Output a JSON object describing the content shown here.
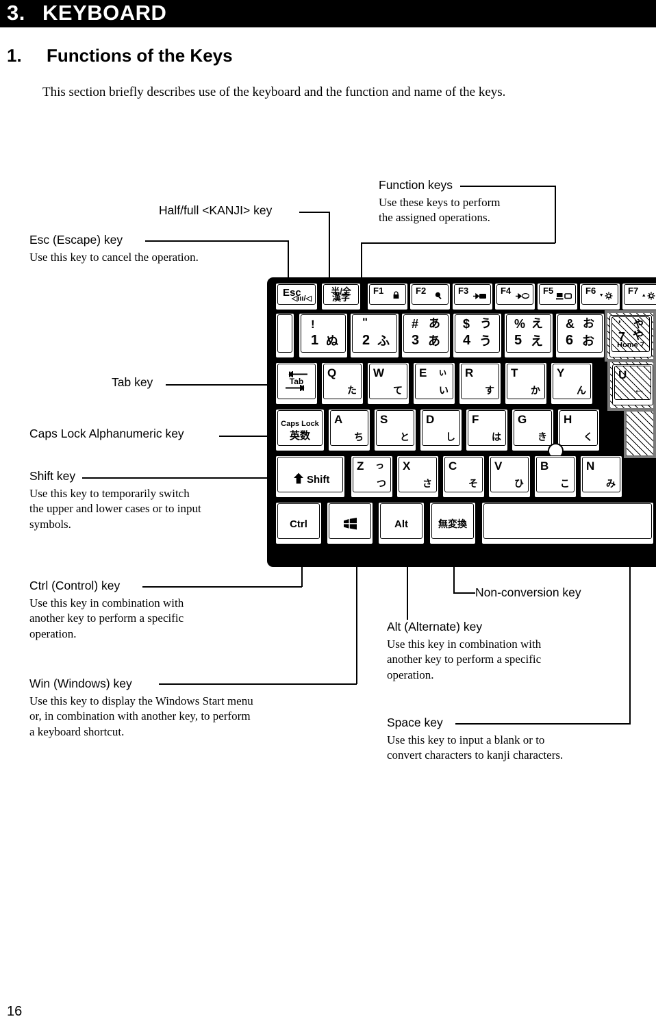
{
  "header": {
    "chapter_number": "3.",
    "chapter_title": "KEYBOARD",
    "section_number": "1.",
    "section_title": "Functions of the Keys",
    "intro": "This section briefly describes use of the keyboard and the function and name of the keys."
  },
  "page_number": "16",
  "annotations": [
    {
      "id": "function-keys",
      "heading": "Function keys",
      "body": "Use these keys to perform\nthe assigned operations."
    },
    {
      "id": "half-full-kanji",
      "heading": "Half/full <KANJI> key",
      "body": ""
    },
    {
      "id": "esc",
      "heading": "Esc (Escape) key",
      "body": "Use this key to cancel the operation."
    },
    {
      "id": "tab",
      "heading": "Tab key",
      "body": ""
    },
    {
      "id": "caps-lock",
      "heading": "Caps Lock Alphanumeric key",
      "body": ""
    },
    {
      "id": "shift",
      "heading": "Shift key",
      "body": "Use this key to temporarily switch\nthe upper and lower cases or to input\nsymbols."
    },
    {
      "id": "ctrl",
      "heading": "Ctrl (Control) key",
      "body": "Use this key in combination with\nanother key to perform a specific\noperation."
    },
    {
      "id": "win",
      "heading": "Win (Windows) key",
      "body": "Use this key to display the Windows Start menu\nor, in combination with another key, to perform\na keyboard shortcut."
    },
    {
      "id": "non-conversion",
      "heading": "Non-conversion key",
      "body": ""
    },
    {
      "id": "alt",
      "heading": "Alt (Alternate) key",
      "body": "Use this key in combination with\nanother key to perform a specific\noperation."
    },
    {
      "id": "space",
      "heading": "Space key",
      "body": "Use this key to input a blank or to\nconvert characters to kanji characters."
    }
  ],
  "keyboard": {
    "function_row": [
      {
        "name": "esc",
        "label": "Esc",
        "sub": "◁ııı/◁",
        "icon": "volume-icon"
      },
      {
        "name": "hankaku",
        "label": "半/全",
        "sub": "漢字",
        "icon": ""
      },
      {
        "name": "f1",
        "label": "F1",
        "icon": "lock-icon"
      },
      {
        "name": "f2",
        "label": "F2",
        "icon": "magnifier-icon"
      },
      {
        "name": "f3",
        "label": "F3",
        "icon": "arrow-to-chip-icon"
      },
      {
        "name": "f4",
        "label": "F4",
        "icon": "arrow-to-disc-icon"
      },
      {
        "name": "f5",
        "label": "F5",
        "icon": "display-switch-icon"
      },
      {
        "name": "f6",
        "label": "F6",
        "icon": "brightness-down-icon"
      },
      {
        "name": "f7",
        "label": "F7",
        "icon": "brightness-up-icon"
      }
    ],
    "number_row": [
      {
        "name": "key-1",
        "top": "!",
        "num": "1",
        "kana": "ぬ"
      },
      {
        "name": "key-2",
        "top": "\"",
        "num": "2",
        "kana": "ふ"
      },
      {
        "name": "key-3",
        "top": "#",
        "num": "3",
        "kana_top": "あ",
        "kana": "あ"
      },
      {
        "name": "key-4",
        "top": "$",
        "num": "4",
        "kana_top": "う",
        "kana": "う"
      },
      {
        "name": "key-5",
        "top": "%",
        "num": "5",
        "kana_top": "え",
        "kana": "え"
      },
      {
        "name": "key-6",
        "top": "&",
        "num": "6",
        "kana_top": "お",
        "kana": "お"
      },
      {
        "name": "key-7",
        "top": "'",
        "num": "7",
        "kana_top": "や",
        "kana": "や",
        "keypad": "Home 7",
        "overlay": true
      }
    ],
    "q_row": [
      {
        "name": "tab",
        "label": "Tab",
        "icon": "tab-arrows-icon"
      },
      {
        "name": "key-q",
        "letter": "Q",
        "kana": "た"
      },
      {
        "name": "key-w",
        "letter": "W",
        "kana": "て"
      },
      {
        "name": "key-e",
        "letter": "E",
        "kana_top": "ぃ",
        "kana": "い"
      },
      {
        "name": "key-r",
        "letter": "R",
        "kana": "す"
      },
      {
        "name": "key-t",
        "letter": "T",
        "kana": "か"
      },
      {
        "name": "key-y",
        "letter": "Y",
        "kana": "ん"
      },
      {
        "name": "key-u",
        "letter": "U",
        "kana": "←",
        "overlay": true
      }
    ],
    "a_row": [
      {
        "name": "caps-lock",
        "label": "Caps Lock",
        "sub": "英数"
      },
      {
        "name": "key-a",
        "letter": "A",
        "kana": "ち"
      },
      {
        "name": "key-s",
        "letter": "S",
        "kana": "と"
      },
      {
        "name": "key-d",
        "letter": "D",
        "kana": "し"
      },
      {
        "name": "key-f",
        "letter": "F",
        "kana": "は"
      },
      {
        "name": "key-g",
        "letter": "G",
        "kana": "き"
      },
      {
        "name": "key-h",
        "letter": "H",
        "kana": "く"
      }
    ],
    "z_row": [
      {
        "name": "shift",
        "label": "Shift",
        "icon": "shift-arrow-icon"
      },
      {
        "name": "key-z",
        "letter": "Z",
        "kana_top": "っ",
        "kana": "つ"
      },
      {
        "name": "key-x",
        "letter": "X",
        "kana": "さ"
      },
      {
        "name": "key-c",
        "letter": "C",
        "kana": "そ"
      },
      {
        "name": "key-v",
        "letter": "V",
        "kana": "ひ"
      },
      {
        "name": "key-b",
        "letter": "B",
        "kana": "こ"
      },
      {
        "name": "key-n",
        "letter": "N",
        "kana": "み"
      }
    ],
    "bottom_row": [
      {
        "name": "ctrl",
        "label": "Ctrl"
      },
      {
        "name": "win",
        "label": "",
        "icon": "windows-icon"
      },
      {
        "name": "alt",
        "label": "Alt"
      },
      {
        "name": "muhenkan",
        "label": "無変換"
      },
      {
        "name": "space",
        "label": ""
      }
    ]
  }
}
